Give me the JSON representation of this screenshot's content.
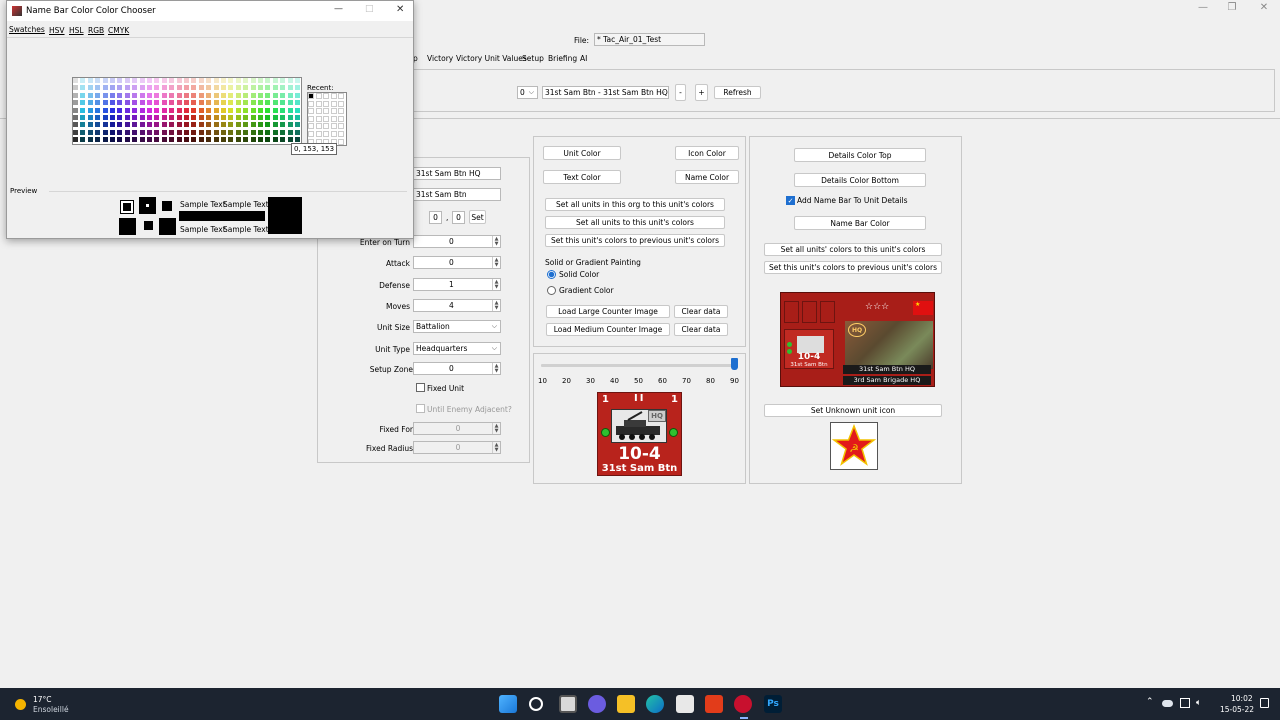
{
  "main": {
    "file_label": "File:",
    "file_value": "* Tac_Air_01_Test",
    "menu": [
      "p",
      "Victory",
      "Victory Unit Values",
      "Setup",
      "Briefing",
      "AI"
    ],
    "number_select": "0",
    "unit_select": "31st Sam Btn - 31st Sam Btn HQ",
    "minus_label": "-",
    "plus_label": "+",
    "refresh_label": "Refresh",
    "ctrl_min": "—",
    "ctrl_max": "❐",
    "ctrl_close": "✕"
  },
  "form": {
    "name_value": "31st Sam Btn HQ",
    "short_name_value": "31st Sam Btn",
    "coord_x": "0",
    "coord_sep": ",",
    "coord_y": "0",
    "set_label": "Set",
    "enter_on_turn_label": "Enter on Turn",
    "enter_on_turn_value": "0",
    "attack_label": "Attack",
    "attack_value": "0",
    "defense_label": "Defense",
    "defense_value": "1",
    "moves_label": "Moves",
    "moves_value": "4",
    "unit_size_label": "Unit Size",
    "unit_size_value": "Battalion",
    "unit_type_label": "Unit Type",
    "unit_type_value": "Headquarters",
    "setup_zone_label": "Setup Zone",
    "setup_zone_value": "0",
    "fixed_unit_label": "Fixed Unit",
    "until_enemy_label": "Until Enemy Adjacent?",
    "fixed_for_label": "Fixed For",
    "fixed_for_value": "0",
    "fixed_radius_label": "Fixed Radius",
    "fixed_radius_value": "0"
  },
  "colors_panel": {
    "unit_color": "Unit Color",
    "icon_color": "Icon Color",
    "text_color": "Text Color",
    "name_color": "Name Color",
    "set_all_org": "Set all units in this org to this unit's colors",
    "set_all_units": "Set all units to this unit's colors",
    "set_previous": "Set this unit's colors to previous unit's colors",
    "painting_label": "Solid or Gradient Painting",
    "solid_label": "Solid Color",
    "gradient_label": "Gradient Color",
    "load_large": "Load Large Counter Image",
    "load_medium": "Load Medium Counter Image",
    "clear_data": "Clear data",
    "clear_data_2": "Clear data"
  },
  "slider": {
    "ticks": [
      "10",
      "20",
      "30",
      "40",
      "50",
      "60",
      "70",
      "80",
      "90"
    ],
    "value": 90,
    "min": 10,
    "max": 90
  },
  "counter": {
    "top_left": "1",
    "size_marker": "II",
    "top_right": "1",
    "hq_text": "HQ",
    "values": "10-4",
    "name": "31st Sam Btn"
  },
  "details_panel": {
    "color_top": "Details Color Top",
    "color_bottom": "Details Color Bottom",
    "add_name_bar": "Add Name Bar To Unit Details",
    "name_bar_color": "Name Bar Color",
    "set_all_units_colors": "Set all units' colors to this unit's colors",
    "set_previous_colors": "Set this unit's colors to previous unit's colors",
    "card_values": "10-4",
    "card_small_name": "31st Sam Btn",
    "card_name": "31st Sam Btn HQ",
    "card_parent": "3rd Sam Brigade HQ",
    "card_stars": "☆☆☆",
    "card_hq": "HQ",
    "set_unknown_icon": "Set Unknown unit icon"
  },
  "chooser": {
    "title": "Name Bar Color Color Chooser",
    "tabs": [
      "Swatches",
      "HSV",
      "HSL",
      "RGB",
      "CMYK"
    ],
    "recent_label": "Recent:",
    "tooltip": "0, 153, 153",
    "preview_label": "Preview",
    "sample_text": "Sample Text",
    "ctrl_min": "—",
    "ctrl_max": "□",
    "ctrl_close": "✕"
  },
  "taskbar": {
    "temp": "17°C",
    "weather": "Ensoleillé",
    "time": "10:02",
    "date": "15-05-22",
    "tray_up": "⌃",
    "ps": "Ps"
  },
  "colors": {
    "accent": "#1e6fd0",
    "counter_red": "#b8231c",
    "taskbar": "#1c2430"
  }
}
